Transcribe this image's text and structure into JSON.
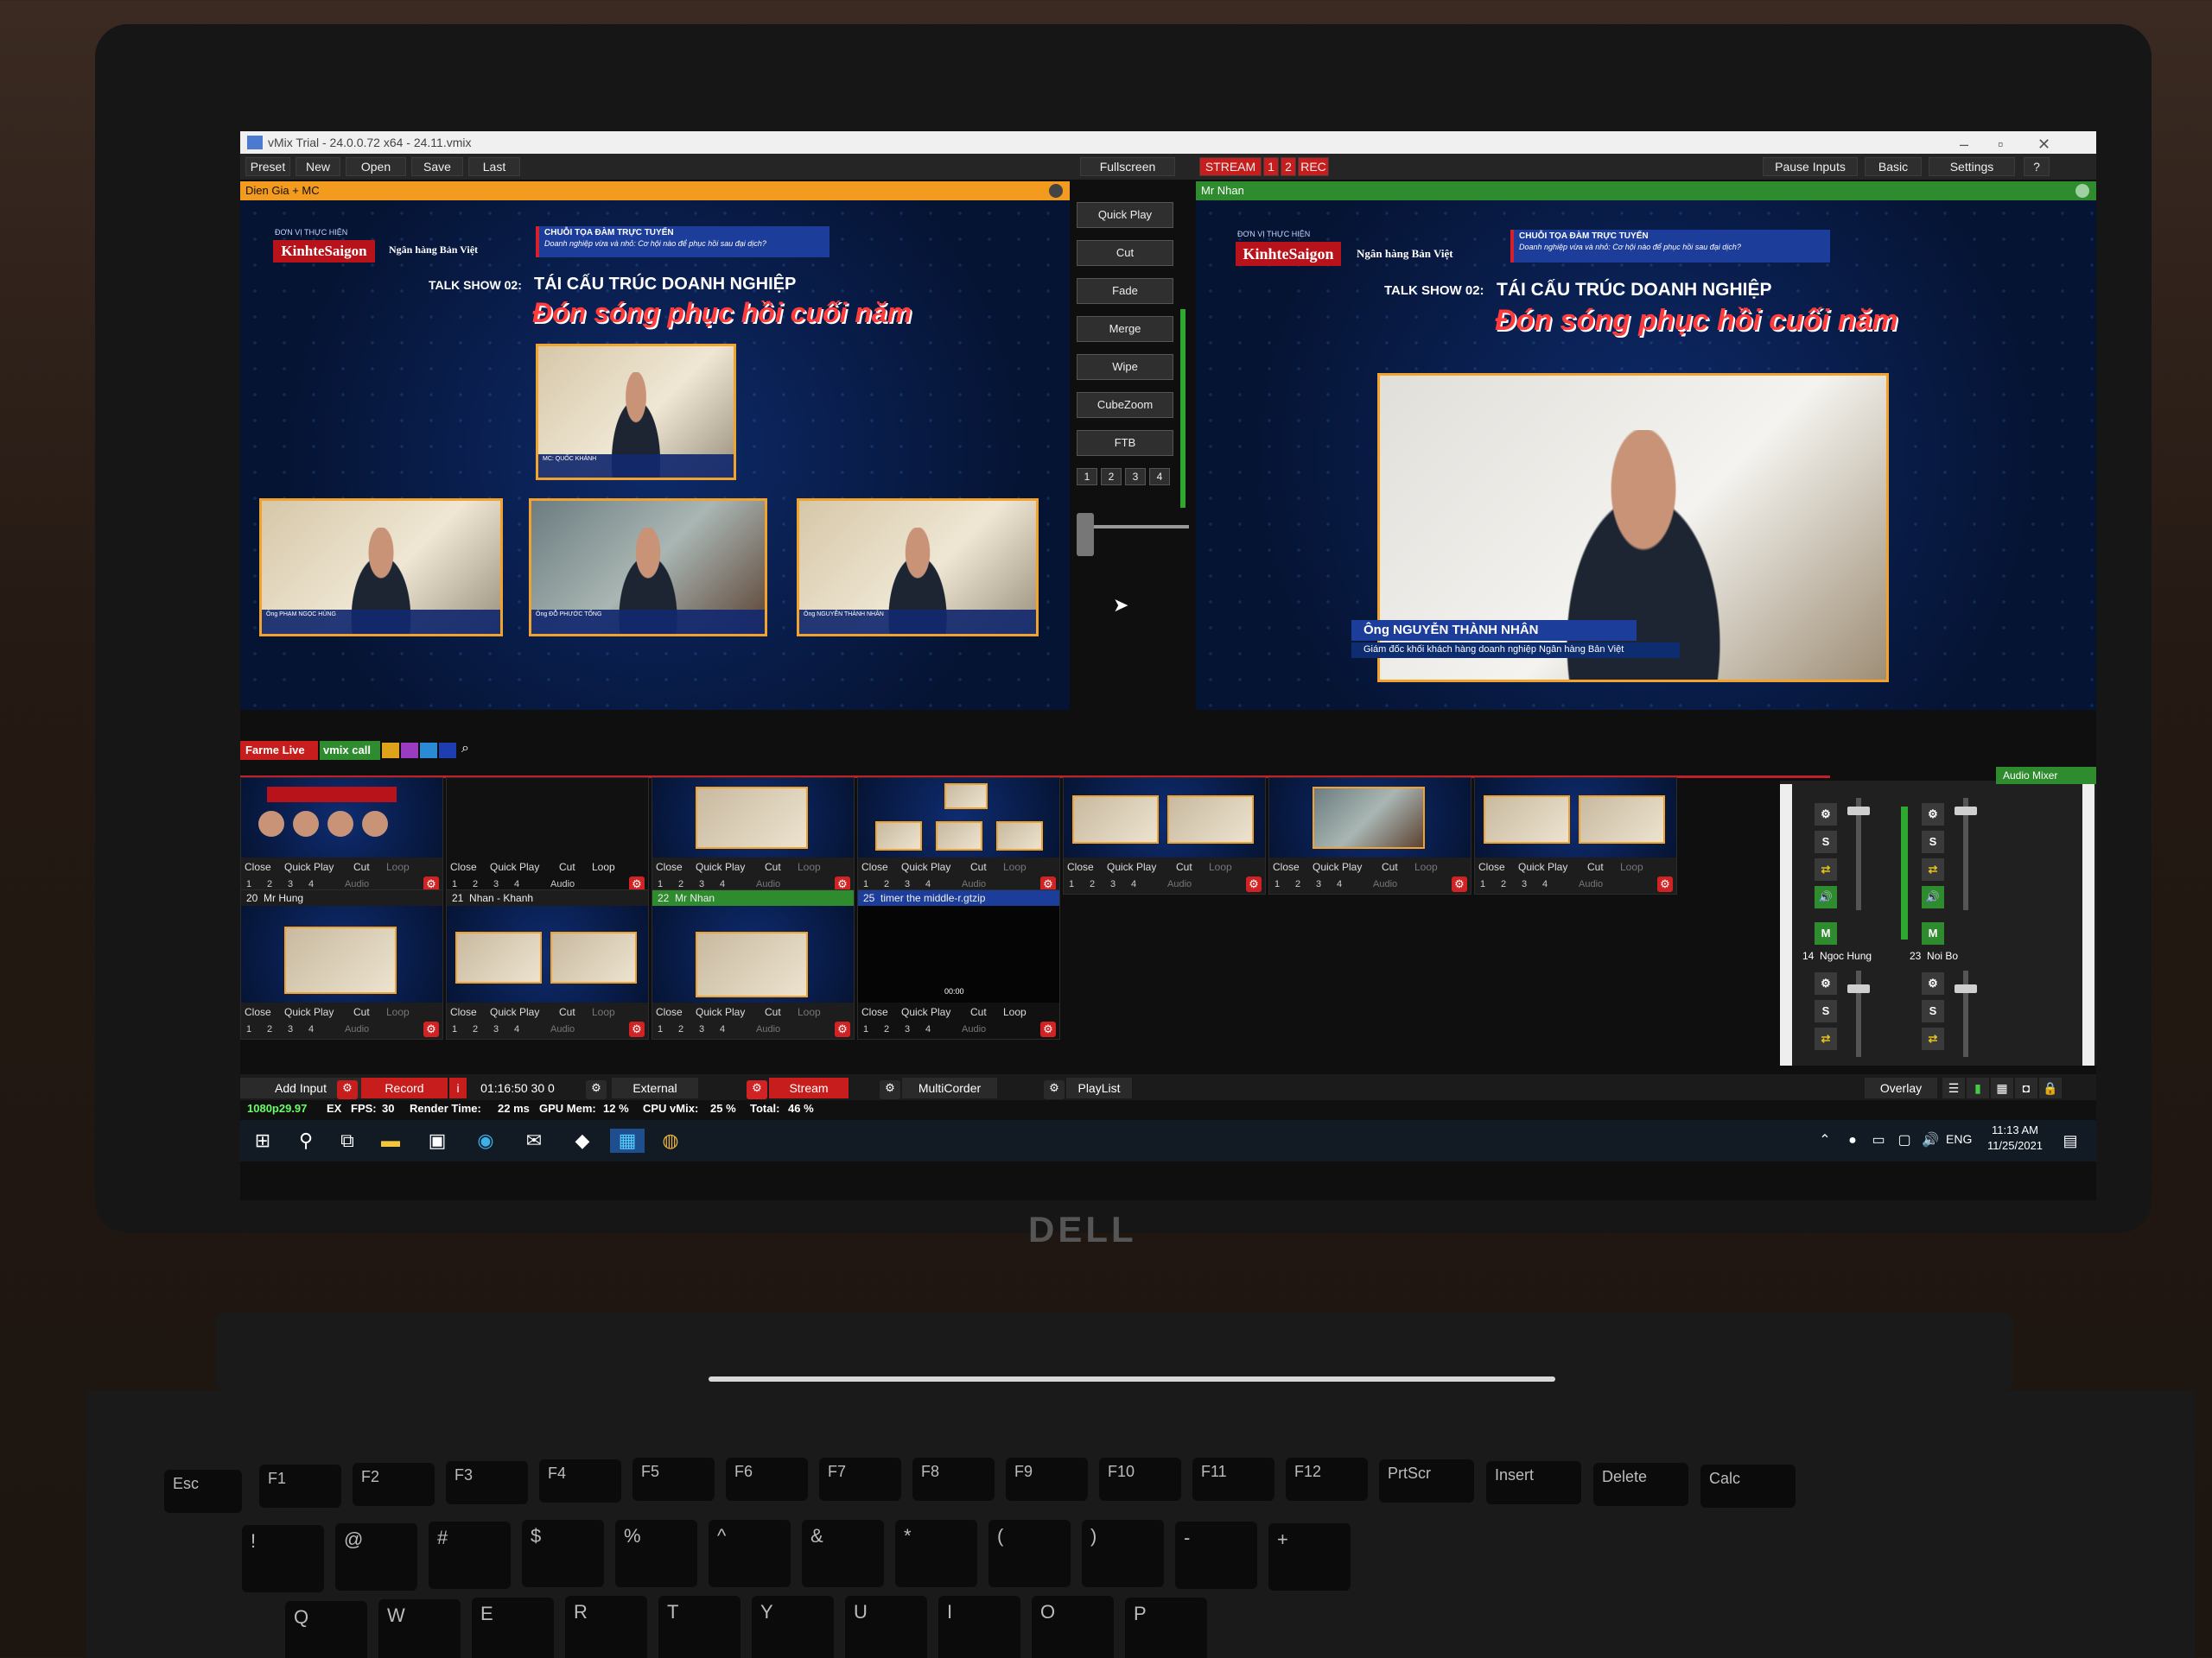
{
  "window": {
    "title": "vMix Trial - 24.0.0.72 x64 - 24.11.vmix"
  },
  "toolbar": {
    "preset": "Preset",
    "new": "New",
    "open": "Open",
    "save": "Save",
    "last": "Last",
    "fullscreen": "Fullscreen",
    "stream": "STREAM",
    "stream1": "1",
    "stream2": "2",
    "rec": "REC",
    "pause_inputs": "Pause Inputs",
    "basic": "Basic",
    "settings": "Settings",
    "help": "?"
  },
  "preview": {
    "title": "Dien Gia + MC"
  },
  "output": {
    "title": "Mr Nhan"
  },
  "graphics": {
    "org_label": "ĐƠN VỊ THỰC HIỆN",
    "ks_logo": "KinhteSaigon",
    "bank_logo": "Ngân hàng Bản Việt",
    "series_title": "CHUỖI TỌA ĐÀM TRỰC TUYẾN",
    "series_sub": "Doanh nghiệp vừa và nhỏ: Cơ hội nào để phục hồi sau đại dịch?",
    "talkshow": "TALK SHOW 02:",
    "headline1": "TÁI CẤU TRÚC DOANH NGHIỆP",
    "headline2": "Đón sóng phục hồi cuối năm",
    "cap_mc": "MC: QUỐC KHÁNH",
    "cap_hung": "Ông PHẠM NGỌC HÙNG",
    "cap_tong": "Ông ĐỖ PHƯỚC TỐNG",
    "cap_nhan": "Ông NGUYỄN THÀNH NHÂN",
    "nhan_name": "Ông NGUYỄN THÀNH NHÂN",
    "nhan_role": "Giám đốc khối khách hàng doanh nghiệp Ngân hàng Bản Việt"
  },
  "transitions": {
    "quick_play": "Quick Play",
    "cut": "Cut",
    "fade": "Fade",
    "merge": "Merge",
    "wipe": "Wipe",
    "cubezoom": "CubeZoom",
    "ftb": "FTB",
    "nums": [
      "1",
      "2",
      "3",
      "4"
    ]
  },
  "input_tabs": {
    "tab1": "Farme Live",
    "tab2": "vmix call"
  },
  "tile_controls": {
    "close": "Close",
    "quick_play": "Quick Play",
    "cut": "Cut",
    "loop": "Loop",
    "audio": "Audio"
  },
  "inputs": [
    {
      "num": "20",
      "name": "Mr Hung"
    },
    {
      "num": "21",
      "name": "Nhan - Khanh"
    },
    {
      "num": "22",
      "name": "Mr Nhan"
    },
    {
      "num": "25",
      "name": "timer the middle-r.gtzip"
    }
  ],
  "timer_text": "00:00",
  "bottom": {
    "add_input": "Add Input",
    "record": "Record",
    "rec_info": "i",
    "record_time": "01:16:50 30 0",
    "external": "External",
    "stream": "Stream",
    "multicorder": "MultiCorder",
    "playlist": "PlayList",
    "overlay": "Overlay"
  },
  "mixer": {
    "title": "Audio Mixer",
    "ch1_num": "14",
    "ch1_name": "Ngoc Hung",
    "ch2_num": "23",
    "ch2_name": "Noi Bo",
    "s": "S",
    "m": "M"
  },
  "status": {
    "format": "1080p29.97",
    "ex": "EX",
    "fps_label": "FPS:",
    "fps": "30",
    "render_label": "Render Time:",
    "render": "22 ms",
    "gpu_label": "GPU Mem:",
    "gpu": "12 %",
    "cpu_label": "CPU vMix:",
    "cpu": "25 %",
    "total_label": "Total:",
    "total": "46 %"
  },
  "taskbar": {
    "lang": "ENG",
    "time": "11:13 AM",
    "date": "11/25/2021"
  },
  "laptop": {
    "brand": "DELL"
  },
  "keyboard": {
    "row1": [
      "Esc",
      "F1",
      "F2",
      "F3",
      "F4",
      "F5",
      "F6",
      "F7",
      "F8",
      "F9",
      "F10",
      "F11",
      "F12",
      "PrtScr",
      "Insert",
      "Delete",
      "Calc"
    ],
    "row2": [
      "!",
      "@",
      "#",
      "$",
      "%",
      "^",
      "&",
      "*",
      "(",
      ")",
      "-",
      "+"
    ],
    "row3": [
      "Q",
      "W",
      "E",
      "R",
      "T",
      "Y",
      "U",
      "I",
      "O",
      "P"
    ]
  },
  "colors": {
    "preview_header": "#f29b1e",
    "output_header": "#2e8b2e",
    "record": "#c81d1d",
    "accent_blue": "#1d3d9a"
  }
}
